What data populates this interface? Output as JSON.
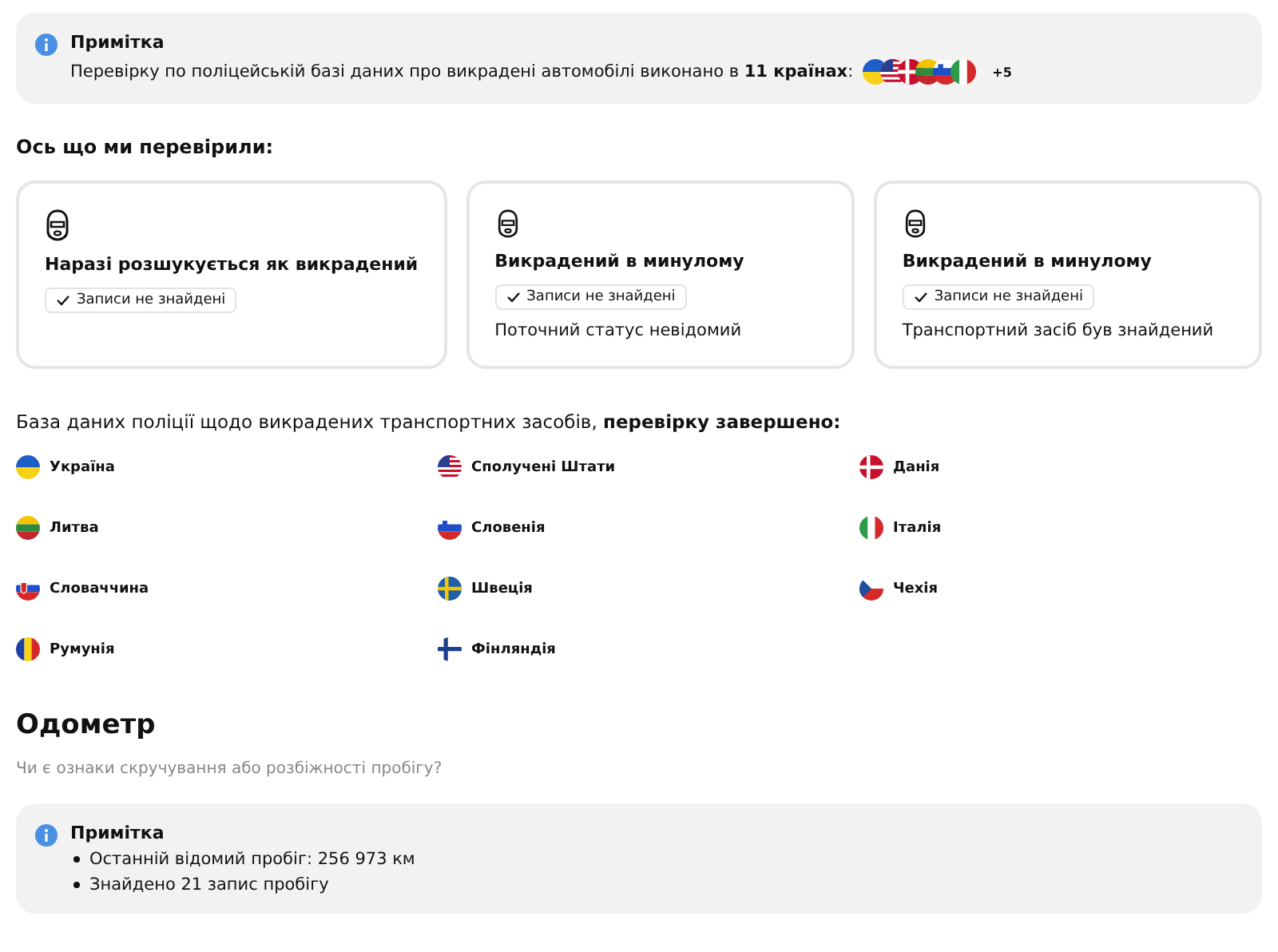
{
  "note": {
    "title": "Примітка",
    "text": "Перевірку по поліцейській базі даних про викрадені автомобілі виконано в **11 країнах**:",
    "flags": [
      {
        "kind": "ua"
      },
      {
        "kind": "us"
      },
      {
        "kind": "dk"
      },
      {
        "kind": "lt"
      },
      {
        "kind": "si"
      },
      {
        "kind": "it"
      }
    ],
    "more": "+5"
  },
  "checks_heading": "Ось що ми перевірили:",
  "cards": [
    {
      "title": "Наразі розшукується як викрадений",
      "tag": "Записи не знайдені"
    },
    {
      "title": "Викрадений в минулому",
      "tag": "Записи не знайдені",
      "text": "Поточний статус невідомий"
    },
    {
      "title": "Викрадений в минулому",
      "tag": "Записи не знайдені",
      "text": "Транспортний засіб був знайдений"
    }
  ],
  "database_text": "База даних поліції щодо викрадених транспортних засобів, **перевірку завершено:**",
  "countries": [
    {
      "name": "Україна",
      "kind": "ua"
    },
    {
      "name": "Сполучені Штати",
      "kind": "us"
    },
    {
      "name": "Данія",
      "kind": "dk"
    },
    {
      "name": "Литва",
      "kind": "lt"
    },
    {
      "name": "Словенія",
      "kind": "si"
    },
    {
      "name": "Італія",
      "kind": "it"
    },
    {
      "name": "Словаччина",
      "kind": "sk"
    },
    {
      "name": "Швеція",
      "kind": "se"
    },
    {
      "name": "Чехія",
      "kind": "cz"
    },
    {
      "name": "Румунія",
      "kind": "ro"
    },
    {
      "name": "Фінляндія",
      "kind": "fi"
    }
  ],
  "odometer": {
    "title": "Одометр",
    "subtitle": "Чи є ознаки скручування або розбіжності пробігу?",
    "note": {
      "title": "Примітка",
      "items": [
        "Останній відомий пробіг: 256 973 км",
        "Знайдено 21 запис пробігу"
      ]
    }
  }
}
